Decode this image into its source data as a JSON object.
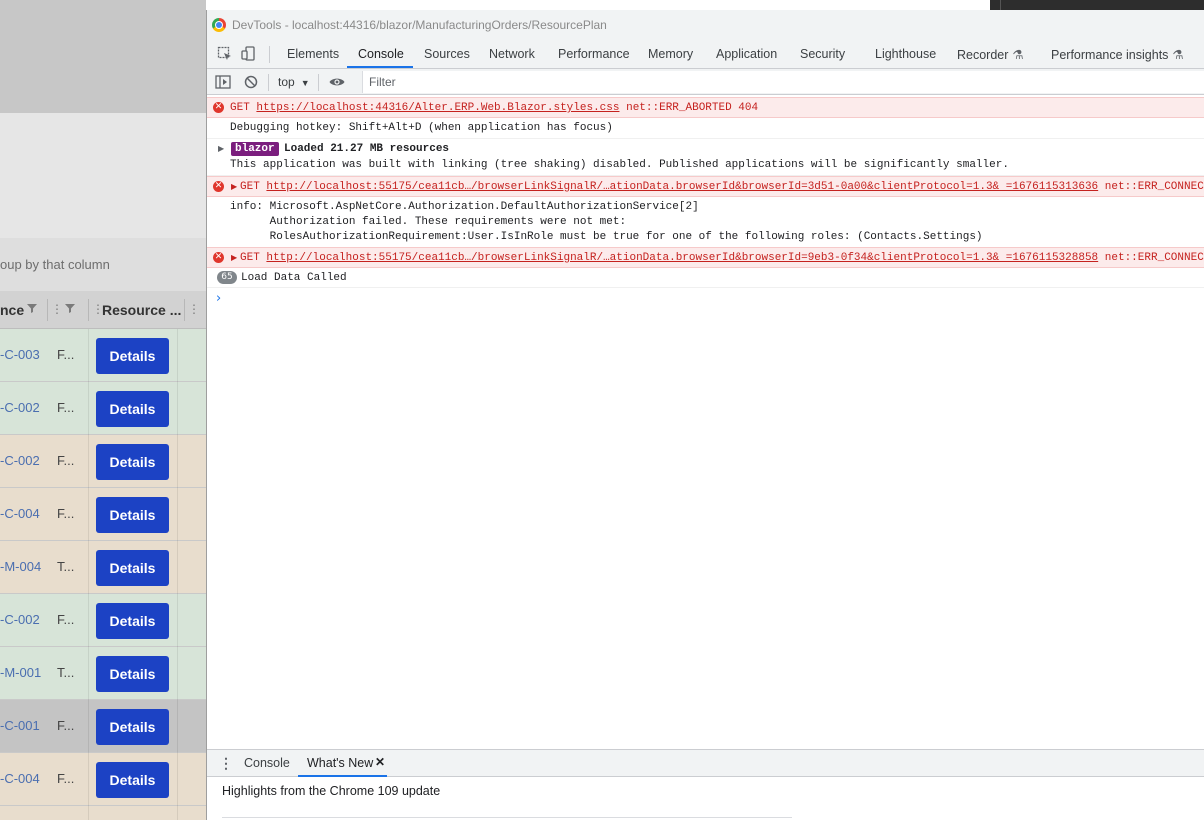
{
  "background_app": {
    "group_hint": "oup by that column",
    "headers": {
      "col1": "nce",
      "col3": "Resource ..."
    },
    "rows": [
      {
        "code": "-C-003",
        "abbr": "F...",
        "button": "Details",
        "color": "#d7e4d8"
      },
      {
        "code": "-C-002",
        "abbr": "F...",
        "button": "Details",
        "color": "#d7e4d8"
      },
      {
        "code": "-C-002",
        "abbr": "F...",
        "button": "Details",
        "color": "#e8ddcd"
      },
      {
        "code": "-C-004",
        "abbr": "F...",
        "button": "Details",
        "color": "#e8ddcd"
      },
      {
        "code": "-M-004",
        "abbr": "T...",
        "button": "Details",
        "color": "#e8ddcd"
      },
      {
        "code": "-C-002",
        "abbr": "F...",
        "button": "Details",
        "color": "#d7e4d8"
      },
      {
        "code": "-M-001",
        "abbr": "T...",
        "button": "Details",
        "color": "#d7e4d8"
      },
      {
        "code": "-C-001",
        "abbr": "F...",
        "button": "Details",
        "color": "#c4c4c4"
      },
      {
        "code": "-C-004",
        "abbr": "F...",
        "button": "Details",
        "color": "#e8ddcd"
      },
      {
        "code": "",
        "abbr": "",
        "button": "",
        "color": "#e8ddcd"
      }
    ]
  },
  "devtools": {
    "window_title": "DevTools - localhost:44316/blazor/ManufacturingOrders/ResourcePlan",
    "tabs": [
      "Elements",
      "Console",
      "Sources",
      "Network",
      "Performance",
      "Memory",
      "Application",
      "Security",
      "Lighthouse",
      "Recorder",
      "Performance insights"
    ],
    "active_tab": "Console",
    "context": "top",
    "filter_placeholder": "Filter",
    "messages": {
      "m1": {
        "method": "GET",
        "url": "https://localhost:44316/Alter.ERP.Web.Blazor.styles.css",
        "status": "net::ERR_ABORTED 404"
      },
      "m2": {
        "text": "Debugging hotkey: Shift+Alt+D (when application has focus)"
      },
      "m3": {
        "badge": "blazor",
        "headline": "Loaded 21.27 MB resources",
        "detail": "This application was built with linking (tree shaking) disabled. Published applications will be significantly smaller."
      },
      "m4": {
        "method": "GET",
        "url": "http://localhost:55175/cea11cb…/browserLinkSignalR/…ationData.browserId&browserId=3d51-0a00&clientProtocol=1.3& =1676115313636",
        "status": "net::ERR_CONNECTION_REFUSED"
      },
      "m5": {
        "lines": [
          "info: Microsoft.AspNetCore.Authorization.DefaultAuthorizationService[2]",
          "      Authorization failed. These requirements were not met:",
          "      RolesAuthorizationRequirement:User.IsInRole must be true for one of the following roles: (Contacts.Settings)"
        ]
      },
      "m6": {
        "method": "GET",
        "url": "http://localhost:55175/cea11cb…/browserLinkSignalR/…ationData.browserId&browserId=9eb3-0f34&clientProtocol=1.3& =1676115328858",
        "status": "net::ERR_CONNECTION_REFUSED"
      },
      "m7": {
        "count": "65",
        "text": "Load Data Called"
      }
    },
    "drawer": {
      "tabs": [
        "Console",
        "What's New"
      ],
      "active_tab": "What's New",
      "heading": "Highlights from the Chrome 109 update"
    }
  },
  "colors": {
    "error_text": "#c5221f",
    "error_bg": "#fcebeb",
    "accent": "#1a73e8",
    "details_button": "#1c42c4",
    "blazor_badge": "#7b1e7e"
  }
}
